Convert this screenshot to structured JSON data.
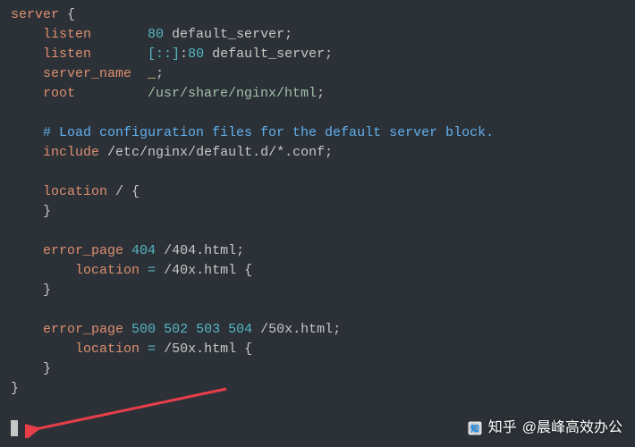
{
  "code": {
    "l01_kw": "server",
    "l01_open": " {",
    "l02_kw": "    listen",
    "l02_pad": "       ",
    "l02_num": "80",
    "l02_rest": " default_server",
    "l02_semi": ";",
    "l03_kw": "    listen",
    "l03_pad": "       ",
    "l03_br1": "[::]",
    "l03_colon": ":",
    "l03_num": "80",
    "l03_rest": " default_server",
    "l03_semi": ";",
    "l04_kw": "    server_name",
    "l04_pad": "  ",
    "l04_us": "_",
    "l04_semi": ";",
    "l05_kw": "    root",
    "l05_pad": "         ",
    "l05_path": "/usr/share/nginx/html",
    "l05_semi": ";",
    "l06_blank": "",
    "l07_comment": "    # Load configuration files for the default server block.",
    "l08_kw": "    include",
    "l08_sp": " ",
    "l08_path": "/etc/nginx/default.d/*.conf",
    "l08_semi": ";",
    "l09_blank": "",
    "l10_kw": "    location",
    "l10_sp": " ",
    "l10_slash": "/",
    "l10_sp2": " ",
    "l10_brace": "{",
    "l11_close": "    }",
    "l12_blank": "",
    "l13_kw": "    error_page",
    "l13_sp": " ",
    "l13_n1": "404",
    "l13_sp2": " ",
    "l13_path": "/404.html",
    "l13_semi": ";",
    "l14_kw": "        location",
    "l14_sp": " ",
    "l14_eq": "=",
    "l14_sp2": " ",
    "l14_path": "/40x.html",
    "l14_sp3": " ",
    "l14_brace": "{",
    "l15_close": "    }",
    "l16_blank": "",
    "l17_kw": "    error_page",
    "l17_sp": " ",
    "l17_n1": "500",
    "l17_sp2": " ",
    "l17_n2": "502",
    "l17_sp3": " ",
    "l17_n3": "503",
    "l17_sp4": " ",
    "l17_n4": "504",
    "l17_sp5": " ",
    "l17_path": "/50x.html",
    "l17_semi": ";",
    "l18_kw": "        location",
    "l18_sp": " ",
    "l18_eq": "=",
    "l18_sp2": " ",
    "l18_path": "/50x.html",
    "l18_sp3": " ",
    "l18_brace": "{",
    "l19_close": "    }",
    "l20_close": "}"
  },
  "watermark": {
    "prefix": "知乎",
    "text": "@晨峰高效办公"
  }
}
